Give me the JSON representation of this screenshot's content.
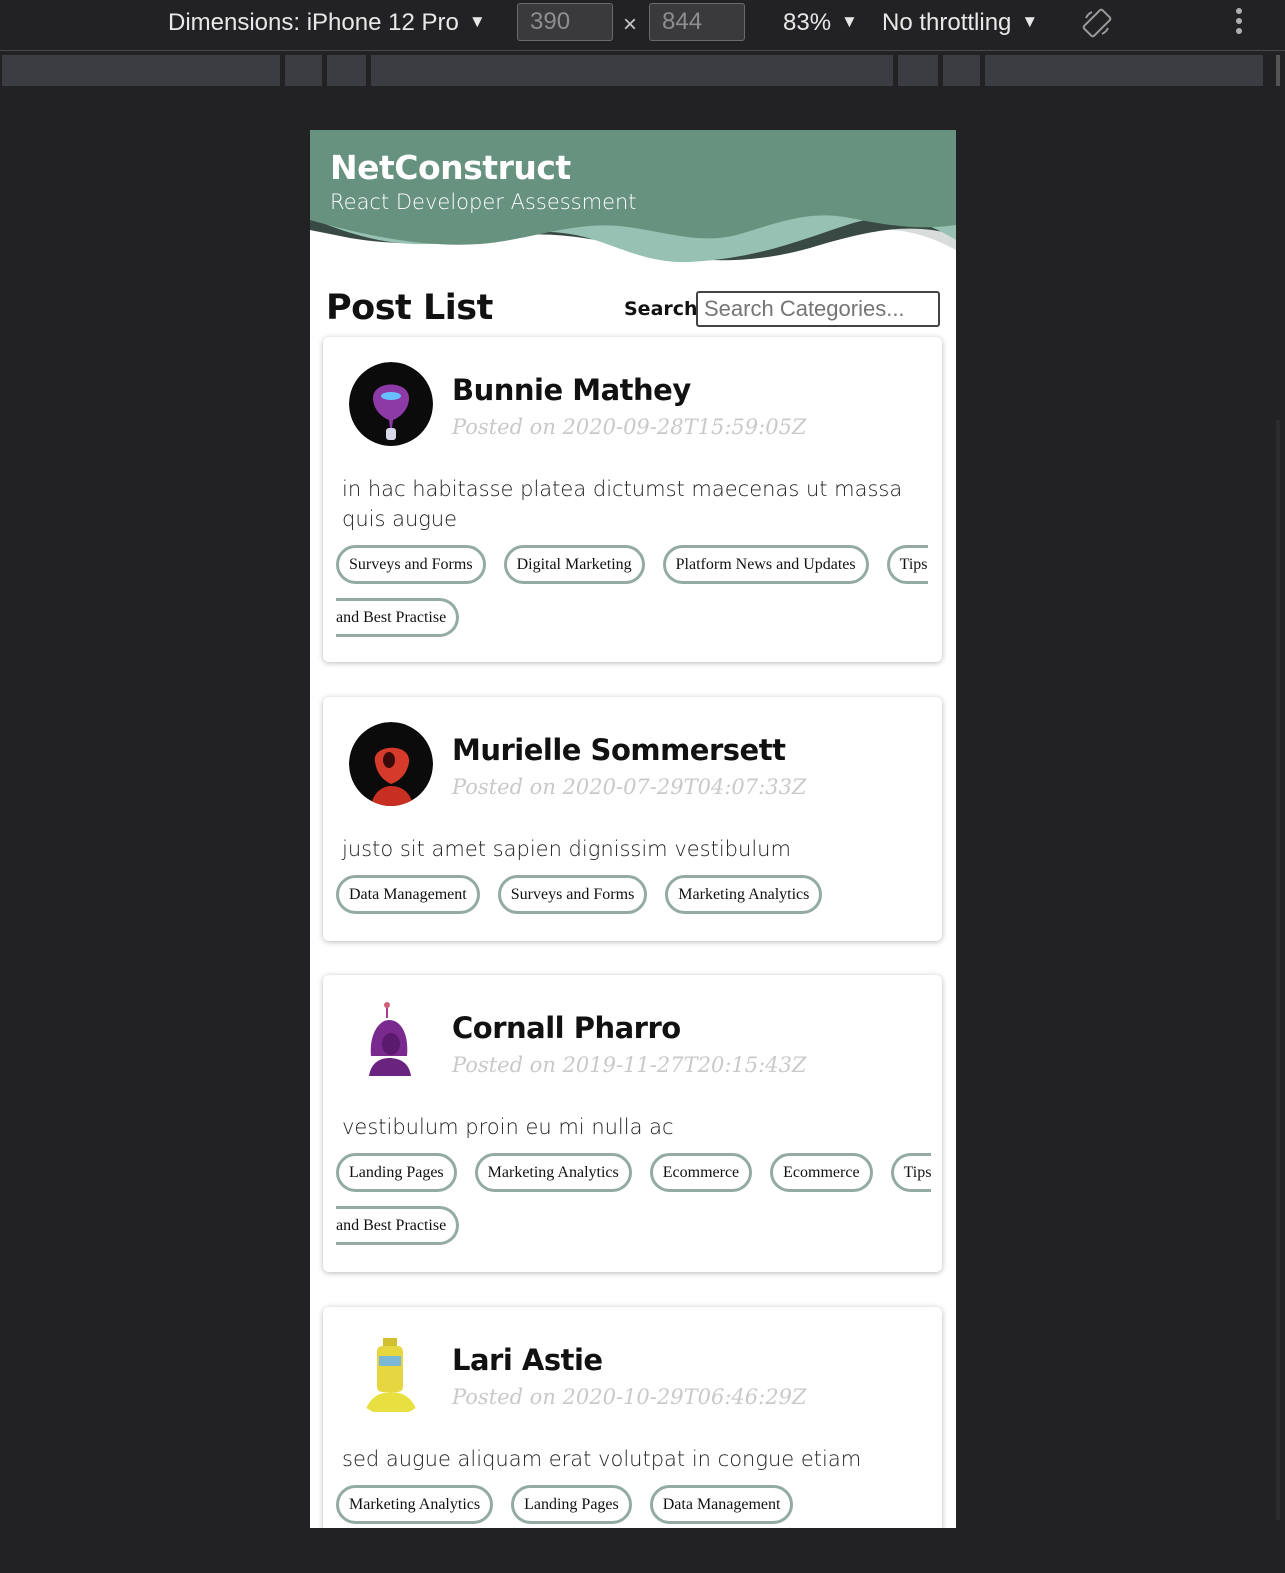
{
  "devtools": {
    "dimensions_label": "Dimensions: iPhone 12 Pro",
    "width_value": "390",
    "height_value": "844",
    "times_symbol": "×",
    "zoom": "83%",
    "throttling": "No throttling",
    "dropdown_arrow": "▼"
  },
  "app": {
    "brand": "NetConstruct",
    "tagline": "React Developer Assessment",
    "colors": {
      "header": "#66927f",
      "wave_light": "#97c2b3",
      "wave_dark": "#384a43",
      "tag_border": "#93aba3"
    }
  },
  "list": {
    "title": "Post List",
    "search_label": "Search:",
    "search_placeholder": "Search Categories...",
    "search_value": ""
  },
  "posts": [
    {
      "author": "Bunnie Mathey",
      "posted": "Posted on 2020-09-28T15:59:05Z",
      "summary": "in hac habitasse platea dictumst maecenas ut massa quis augue",
      "categories": [
        "Surveys and Forms",
        "Digital Marketing",
        "Platform News and Updates",
        "Tips and Best Practise"
      ],
      "avatar": "purple-robot-dark-circle"
    },
    {
      "author": "Murielle Sommersett",
      "posted": "Posted on 2020-07-29T04:07:33Z",
      "summary": "justo sit amet sapien dignissim vestibulum",
      "categories": [
        "Data Management",
        "Surveys and Forms",
        "Marketing Analytics"
      ],
      "avatar": "red-robot-dark-circle"
    },
    {
      "author": "Cornall Pharro",
      "posted": "Posted on 2019-11-27T20:15:43Z",
      "summary": "vestibulum proin eu mi nulla ac",
      "categories": [
        "Landing Pages",
        "Marketing Analytics",
        "Ecommerce",
        "Ecommerce",
        "Tips and Best Practise"
      ],
      "avatar": "purple-robot-white"
    },
    {
      "author": "Lari Astie",
      "posted": "Posted on 2020-10-29T06:46:29Z",
      "summary": "sed augue aliquam erat volutpat in congue etiam",
      "categories": [
        "Marketing Analytics",
        "Landing Pages",
        "Data Management"
      ],
      "avatar": "yellow-robot-white"
    }
  ]
}
